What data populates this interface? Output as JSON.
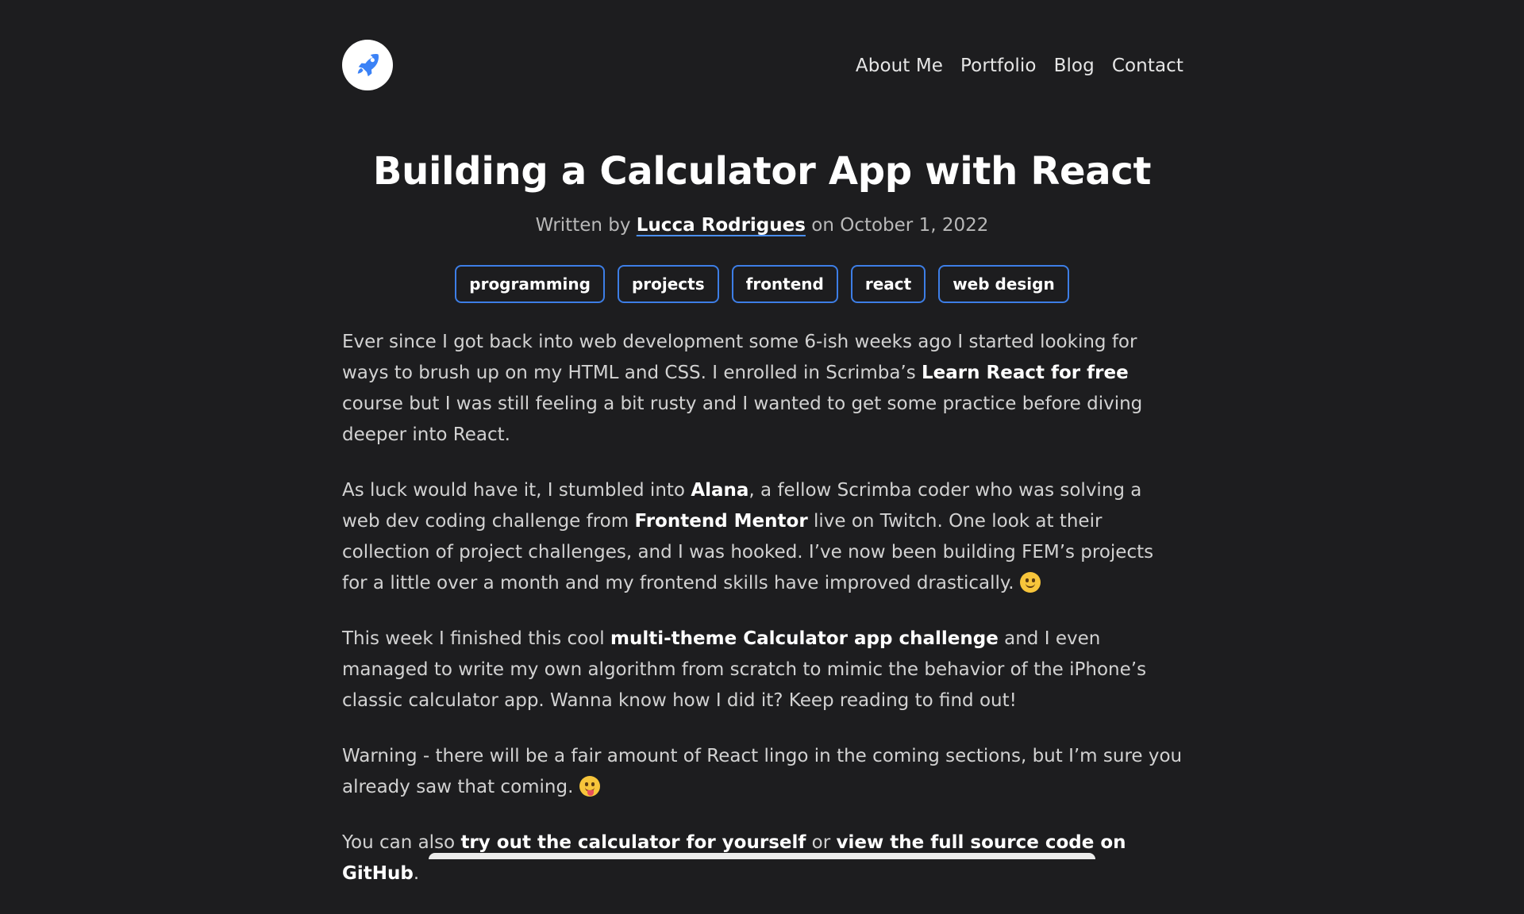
{
  "header": {
    "logo_icon": "rocket-icon",
    "nav": [
      "About Me",
      "Portfolio",
      "Blog",
      "Contact"
    ]
  },
  "article": {
    "title": "Building a Calculator App with React",
    "byline_prefix": "Written by",
    "author": "Lucca Rodrigues",
    "byline_mid": "on",
    "date": "October 1, 2022",
    "tags": [
      "programming",
      "projects",
      "frontend",
      "react",
      "web design"
    ],
    "p1": {
      "t1": "Ever since I got back into web development some 6-ish weeks ago I started looking for ways to brush up on my HTML and CSS. I enrolled in Scrimba’s ",
      "b1": "Learn React for free",
      "t2": " course but I was still feeling a bit rusty and I wanted to get some practice before diving deeper into React."
    },
    "p2": {
      "t1": "As luck would have it, I stumbled into ",
      "b1": "Alana",
      "t2": ", a fellow Scrimba coder who was solving a web dev coding challenge from ",
      "b2": "Frontend Mentor",
      "t3": " live on Twitch. One look at their collection of project challenges, and I was hooked. I’ve now been building FEM’s projects for a little over a month and my frontend skills have improved drastically. "
    },
    "p3": {
      "t1": "This week I finished this cool ",
      "b1": "multi-theme Calculator app challenge",
      "t2": " and I even managed to write my own algorithm from scratch to mimic the behavior of the iPhone’s classic calculator app. Wanna know how I did it? Keep reading to find out!"
    },
    "p4": {
      "t1": "Warning - there will be a fair amount of React lingo in the coming sections, but I’m sure you already saw that coming. "
    },
    "p5": {
      "t1": "You can also ",
      "b1": "try out the calculator for yourself",
      "t2": " or ",
      "b2": "view the full source code on GitHub",
      "t3": "."
    },
    "emoji1": "slightly-smiling-face-icon",
    "emoji2": "winking-face-with-tongue-icon"
  },
  "colors": {
    "background": "#1d1d1f",
    "accent": "#3d7ee6"
  }
}
